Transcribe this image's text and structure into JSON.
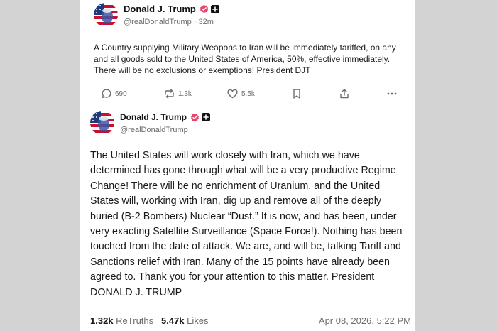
{
  "post1": {
    "author_name": "Donald J. Trump",
    "handle": "@realDonaldTrump",
    "separator": "·",
    "time_ago": "32m",
    "text": "A Country supplying Military Weapons to Iran will be immediately tariffed, on any and all goods sold to the United States of America, 50%, effective immediately. There will be no exclusions or exemptions! President DJT",
    "actions": {
      "replies": "690",
      "retruths": "1.3k",
      "likes": "5.5k"
    }
  },
  "post2": {
    "author_name": "Donald J. Trump",
    "handle": "@realDonaldTrump",
    "text": "The United States will work closely with Iran, which we have determined has gone through what will be a very productive Regime Change! There will be no enrichment of Uranium, and the United States will, working with Iran, dig up and remove all of the deeply buried (B-2 Bombers) Nuclear “Dust.” It is now, and has been, under very exacting Satellite Surveillance (Space Force!). Nothing has been touched from the date of attack. We are, and will be, talking Tariff and Sanctions relief with Iran. Many of the 15 points have already been agreed to. Thank you for your attention to this matter. President DONALD J. TRUMP",
    "retruths_count": "1.32k",
    "retruths_label": "ReTruths",
    "likes_count": "5.47k",
    "likes_label": "Likes",
    "timestamp": "Apr 08, 2026, 5:22 PM"
  },
  "colors": {
    "page_background": "#d3d3d3",
    "card_background": "#ffffff",
    "verified_badge": "#e5466b",
    "text_primary": "#1a1a1a",
    "text_secondary": "#6b6b6b"
  },
  "icons": [
    "avatar-flag-portrait",
    "verified-check-icon",
    "plus-badge-icon",
    "reply-icon",
    "retruth-icon",
    "like-icon",
    "bookmark-icon",
    "share-icon",
    "more-icon"
  ]
}
